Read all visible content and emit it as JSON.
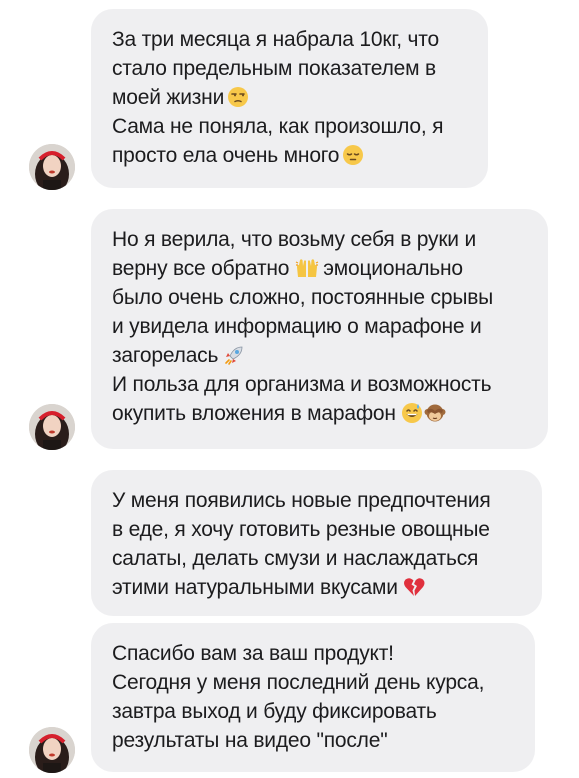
{
  "messages": [
    {
      "lines": [
        {
          "text": "За три месяца я набрала 10кг, что",
          "emoji": []
        },
        {
          "text": "стало предельным показателем в",
          "emoji": []
        },
        {
          "text": "моей жизни",
          "emoji": [
            "unamused-face"
          ]
        },
        {
          "text": "Сама не поняла, как произошло, я",
          "emoji": []
        },
        {
          "text": "просто ела очень много",
          "emoji": [
            "pensive-face"
          ]
        }
      ]
    },
    {
      "lines": [
        {
          "text": "Но я верила, что возьму себя в руки и",
          "emoji": []
        },
        {
          "text": "верну все обратно",
          "emoji": [
            "raising-hands"
          ],
          "after": "эмоционально"
        },
        {
          "text": "было очень сложно, постоянные срывы",
          "emoji": []
        },
        {
          "text": "и увидела информацию о марафоне и",
          "emoji": []
        },
        {
          "text": "загорелась",
          "emoji": [
            "rocket"
          ]
        },
        {
          "text": "И польза для организма и возможность",
          "emoji": []
        },
        {
          "text": "окупить вложения в марафон",
          "emoji": [
            "grinning-sweat-face",
            "see-no-evil-monkey"
          ]
        }
      ]
    },
    {
      "lines": [
        {
          "text": "У меня появились новые предпочтения",
          "emoji": []
        },
        {
          "text": "в еде, я хочу готовить резные овощные",
          "emoji": []
        },
        {
          "text": "салаты, делать смузи и наслаждаться",
          "emoji": []
        },
        {
          "text": "этими натуральными вкусами",
          "emoji": [
            "broken-heart"
          ]
        }
      ]
    },
    {
      "lines": [
        {
          "text": "Спасибо вам за ваш продукт!",
          "emoji": []
        },
        {
          "text": "Сегодня у меня последний день курса,",
          "emoji": []
        },
        {
          "text": "завтра выход и буду фиксировать",
          "emoji": []
        },
        {
          "text": "результаты на видео \"после\"",
          "emoji": []
        }
      ]
    }
  ],
  "colors": {
    "bubble": "#efeff1",
    "text": "#1c1c1e",
    "background": "#ffffff"
  }
}
